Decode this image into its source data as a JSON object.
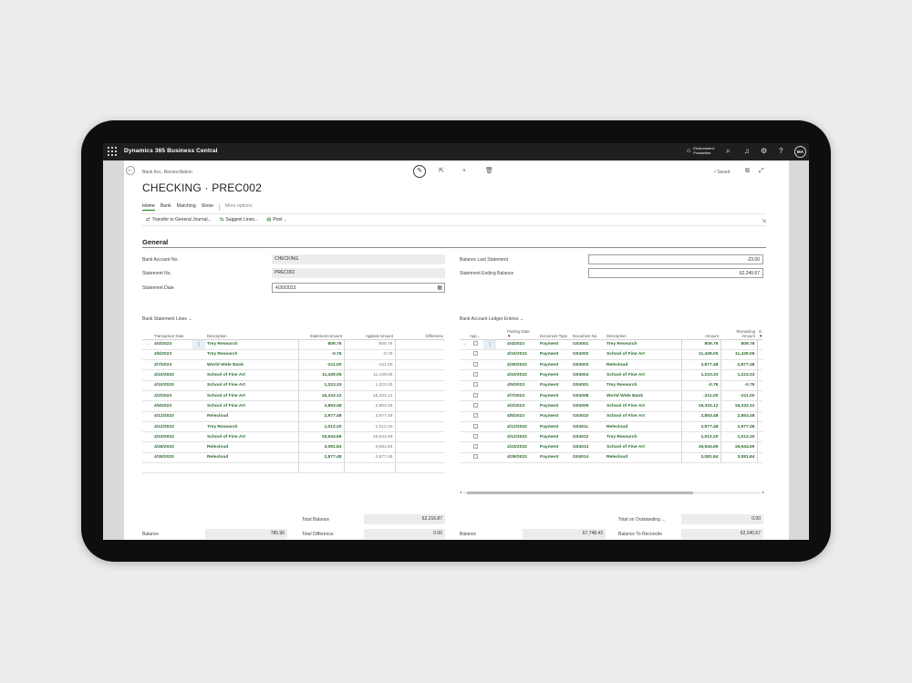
{
  "app": {
    "title": "Dynamics 365 Business Central",
    "environment_line1": "Environment:",
    "environment_line2": "Production",
    "user_initials": "MA"
  },
  "page": {
    "breadcrumb": "Bank Acc. Reconciliation",
    "title": "CHECKING · PREC002",
    "saved_label": "✓Saved"
  },
  "tabs": [
    "Home",
    "Bank",
    "Matching",
    "Show",
    "More options"
  ],
  "actions": {
    "transfer": "Transfer to General Journal...",
    "suggest": "Suggest Lines...",
    "post": "Post"
  },
  "general": {
    "title": "General",
    "bank_account_no_label": "Bank Account No.",
    "bank_account_no": "CHECKING",
    "statement_no_label": "Statement No.",
    "statement_no": "PREC002",
    "statement_date_label": "Statement Date",
    "statement_date": "4/30/2023",
    "balance_last_statement_label": "Balance Last Statement",
    "balance_last_statement": "-23.00",
    "statement_ending_balance_label": "Statement Ending Balance",
    "statement_ending_balance": "62,240.67"
  },
  "statement_lines": {
    "title": "Bank Statement Lines",
    "columns": [
      "Transaction Date",
      "Description",
      "Statement Amount",
      "Applied Amount",
      "Difference"
    ],
    "rows": [
      {
        "date": "4/4/2023",
        "desc": "Trey Research",
        "amount": "809.76",
        "applied": "809.76",
        "diff": ""
      },
      {
        "date": "4/5/2023",
        "desc": "Trey Research",
        "amount": "-0.76",
        "applied": "-0.76",
        "diff": ""
      },
      {
        "date": "4/7/2023",
        "desc": "World Wide Bank",
        "amount": "-211.00",
        "applied": "-211.00",
        "diff": ""
      },
      {
        "date": "4/10/2023",
        "desc": "School of Fine Art",
        "amount": "11,439.05",
        "applied": "11,439.05",
        "diff": ""
      },
      {
        "date": "4/10/2023",
        "desc": "School of Fine Art",
        "amount": "1,223.33",
        "applied": "1,223.33",
        "diff": ""
      },
      {
        "date": "4/2/2023",
        "desc": "School of Fine Art",
        "amount": "16,333.12",
        "applied": "16,333.12",
        "diff": ""
      },
      {
        "date": "4/5/2023",
        "desc": "School of Fine Art",
        "amount": "2,853.48",
        "applied": "2,853.48",
        "diff": ""
      },
      {
        "date": "4/12/2023",
        "desc": "Relecloud",
        "amount": "2,977.48",
        "applied": "2,977.48",
        "diff": ""
      },
      {
        "date": "4/12/2023",
        "desc": "Trey Research",
        "amount": "1,012.20",
        "applied": "1,012.20",
        "diff": ""
      },
      {
        "date": "4/23/2023",
        "desc": "School of Fine Art",
        "amount": "19,944.69",
        "applied": "19,944.69",
        "diff": ""
      },
      {
        "date": "4/26/2023",
        "desc": "Relecloud",
        "amount": "3,081.84",
        "applied": "3,081.84",
        "diff": ""
      },
      {
        "date": "4/30/2023",
        "desc": "Relecloud",
        "amount": "2,877.48",
        "applied": "2,877.48",
        "diff": ""
      }
    ]
  },
  "ledger_entries": {
    "title": "Bank Account Ledger Entries",
    "columns": [
      "App...",
      "Posting Date",
      "Document Type",
      "Document No.",
      "Description",
      "Amount",
      "Remaining Amount",
      "O"
    ],
    "rows": [
      {
        "date": "4/4/2023",
        "type": "Payment",
        "doc": "G04001",
        "desc": "Trey Research",
        "amount": "809.76",
        "remaining": "809.76"
      },
      {
        "date": "4/10/2023",
        "type": "Payment",
        "doc": "G04002",
        "desc": "School of Fine Art",
        "amount": "11,439.05",
        "remaining": "11,439.05"
      },
      {
        "date": "4/30/2023",
        "type": "Payment",
        "doc": "G04003",
        "desc": "Relecloud",
        "amount": "2,877.48",
        "remaining": "2,877.48"
      },
      {
        "date": "4/10/2023",
        "type": "Payment",
        "doc": "G04004",
        "desc": "School of Fine Art",
        "amount": "1,223.33",
        "remaining": "1,223.33"
      },
      {
        "date": "4/5/2023",
        "type": "Payment",
        "doc": "G04001",
        "desc": "Trey Research",
        "amount": "-0.76",
        "remaining": "-0.76"
      },
      {
        "date": "4/7/2023",
        "type": "Payment",
        "doc": "G04008",
        "desc": "World Wide Bank",
        "amount": "-211.00",
        "remaining": "-211.00"
      },
      {
        "date": "4/2/2023",
        "type": "Payment",
        "doc": "G04009",
        "desc": "School of Fine Art",
        "amount": "16,333.12",
        "remaining": "16,333.12"
      },
      {
        "date": "4/5/2023",
        "type": "Payment",
        "doc": "G04010",
        "desc": "School of Fine Art",
        "amount": "2,853.48",
        "remaining": "2,853.48"
      },
      {
        "date": "4/12/2023",
        "type": "Payment",
        "doc": "G04011",
        "desc": "Relecloud",
        "amount": "2,977.48",
        "remaining": "2,977.48"
      },
      {
        "date": "4/12/2023",
        "type": "Payment",
        "doc": "G04012",
        "desc": "Trey Research",
        "amount": "1,012.20",
        "remaining": "1,012.20"
      },
      {
        "date": "4/23/2023",
        "type": "Payment",
        "doc": "G04013",
        "desc": "School of Fine Art",
        "amount": "19,944.69",
        "remaining": "19,944.69"
      },
      {
        "date": "4/29/2023",
        "type": "Payment",
        "doc": "G04014",
        "desc": "Relecloud",
        "amount": "3,081.84",
        "remaining": "3,081.84"
      }
    ]
  },
  "totals": {
    "left_balance_label": "Balance",
    "left_balance": "785.96",
    "total_balance_label": "Total Balance",
    "total_balance": "62,216.87",
    "total_difference_label": "Total Difference",
    "total_difference": "0.00",
    "right_balance_label": "Balance",
    "right_balance": "67,748.43",
    "total_outstanding_label": "Total on Outstanding ...",
    "total_outstanding": "0.00",
    "balance_to_reconcile_label": "Balance To Reconcile",
    "balance_to_reconcile": "62,240.67"
  },
  "icons": [
    "grid-icon",
    "search-icon",
    "bell-icon",
    "gear-icon",
    "help-icon",
    "back-arrow-icon",
    "edit-icon",
    "share-icon",
    "add-icon",
    "delete-icon",
    "open-new-icon",
    "expand-icon",
    "calendar-icon",
    "filter-icon",
    "chevron-left-icon",
    "chevron-right-icon"
  ],
  "colors": {
    "accent_green": "#107c10",
    "amount_green": "#2e6b2e",
    "topbar": "#1f1f1f"
  }
}
